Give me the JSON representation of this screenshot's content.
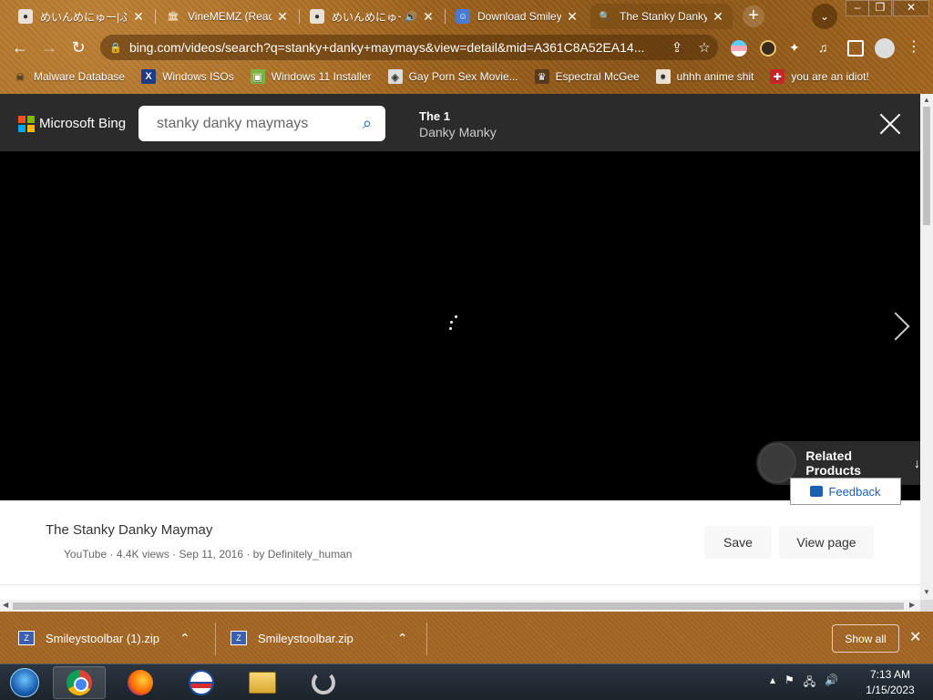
{
  "tabs": [
    {
      "title": "めいんめにゅー|ふぁん",
      "favicon": "anime-avatar-icon",
      "active": false
    },
    {
      "title": "VineMEMZ (Read",
      "favicon": "archive-icon",
      "active": false
    },
    {
      "title": "めいんめにゅー|ふ",
      "favicon": "anime-avatar-icon",
      "active": false,
      "audio": true
    },
    {
      "title": "Download Smileys",
      "favicon": "smiley-shield-icon",
      "active": false
    },
    {
      "title": "The Stanky Danky",
      "favicon": "search-icon",
      "active": true
    }
  ],
  "toolbar": {
    "url": "bing.com/videos/search?q=stanky+danky+maymays&view=detail&mid=A361C8A52EA14..."
  },
  "bookmarks": [
    {
      "label": "Malware Database",
      "icon": "malware-icon"
    },
    {
      "label": "Windows ISOs",
      "icon": "x-icon"
    },
    {
      "label": "Windows 11 Installer",
      "icon": "image-icon"
    },
    {
      "label": "Gay Porn Sex Movie...",
      "icon": "bookmark-icon"
    },
    {
      "label": "Espectral McGee",
      "icon": "bookmark-icon"
    },
    {
      "label": "uhhh anime shit",
      "icon": "anime-avatar-icon"
    },
    {
      "label": "you are an idiot!",
      "icon": "flag-icon"
    }
  ],
  "bing": {
    "brand": "Microsoft Bing",
    "search_value": "stanky danky maymays",
    "video_header_line1": "The 1",
    "video_header_line2": "Danky Manky",
    "related_products": "Related Products",
    "video_title": "The Stanky Danky Maymay",
    "video_meta": "YouTube · 4.4K views · Sep 11, 2016 · by Definitely_human",
    "save_label": "Save",
    "view_page_label": "View page",
    "feedback_label": "Feedback"
  },
  "downloads": {
    "items": [
      {
        "name": "Smileystoolbar (1).zip"
      },
      {
        "name": "Smileystoolbar.zip"
      }
    ],
    "show_all": "Show all"
  },
  "taskbar": {
    "time": "7:13 AM",
    "date": "1/15/2023"
  },
  "colors": {
    "theme_brown": "#a56a23",
    "bing_header": "#2b2b2b",
    "link_blue": "#1a5fb4"
  }
}
